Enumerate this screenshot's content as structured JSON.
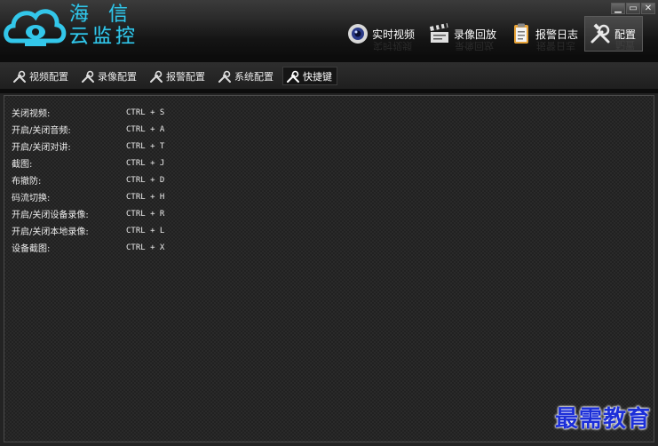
{
  "app": {
    "logo_line1": "海信",
    "logo_line2": "云监控"
  },
  "window_controls": {
    "minimize": "▁",
    "restore": "▭",
    "close": "✕"
  },
  "top_nav": [
    {
      "label": "实时视频",
      "icon": "camera-lens-icon"
    },
    {
      "label": "录像回放",
      "icon": "clapperboard-icon"
    },
    {
      "label": "报警日志",
      "icon": "clipboard-icon"
    },
    {
      "label": "配置",
      "icon": "tools-icon",
      "active": true
    }
  ],
  "sub_tabs": [
    {
      "label": "视频配置"
    },
    {
      "label": "录像配置"
    },
    {
      "label": "报警配置"
    },
    {
      "label": "系统配置"
    },
    {
      "label": "快捷键",
      "active": true
    }
  ],
  "shortcuts": [
    {
      "label": "关闭视频:",
      "key": "CTRL + S"
    },
    {
      "label": "开启/关闭音频:",
      "key": "CTRL + A"
    },
    {
      "label": "开启/关闭对讲:",
      "key": "CTRL + T"
    },
    {
      "label": "截图:",
      "key": "CTRL + J"
    },
    {
      "label": "布撤防:",
      "key": "CTRL + D"
    },
    {
      "label": "码流切换:",
      "key": "CTRL + H"
    },
    {
      "label": "开启/关闭设备录像:",
      "key": "CTRL + R"
    },
    {
      "label": "开启/关闭本地录像:",
      "key": "CTRL + L"
    },
    {
      "label": "设备截图:",
      "key": "CTRL + X"
    }
  ],
  "watermark": "最需教育",
  "colors": {
    "brand": "#33c7ea",
    "watermark": "#1c2fd8"
  }
}
